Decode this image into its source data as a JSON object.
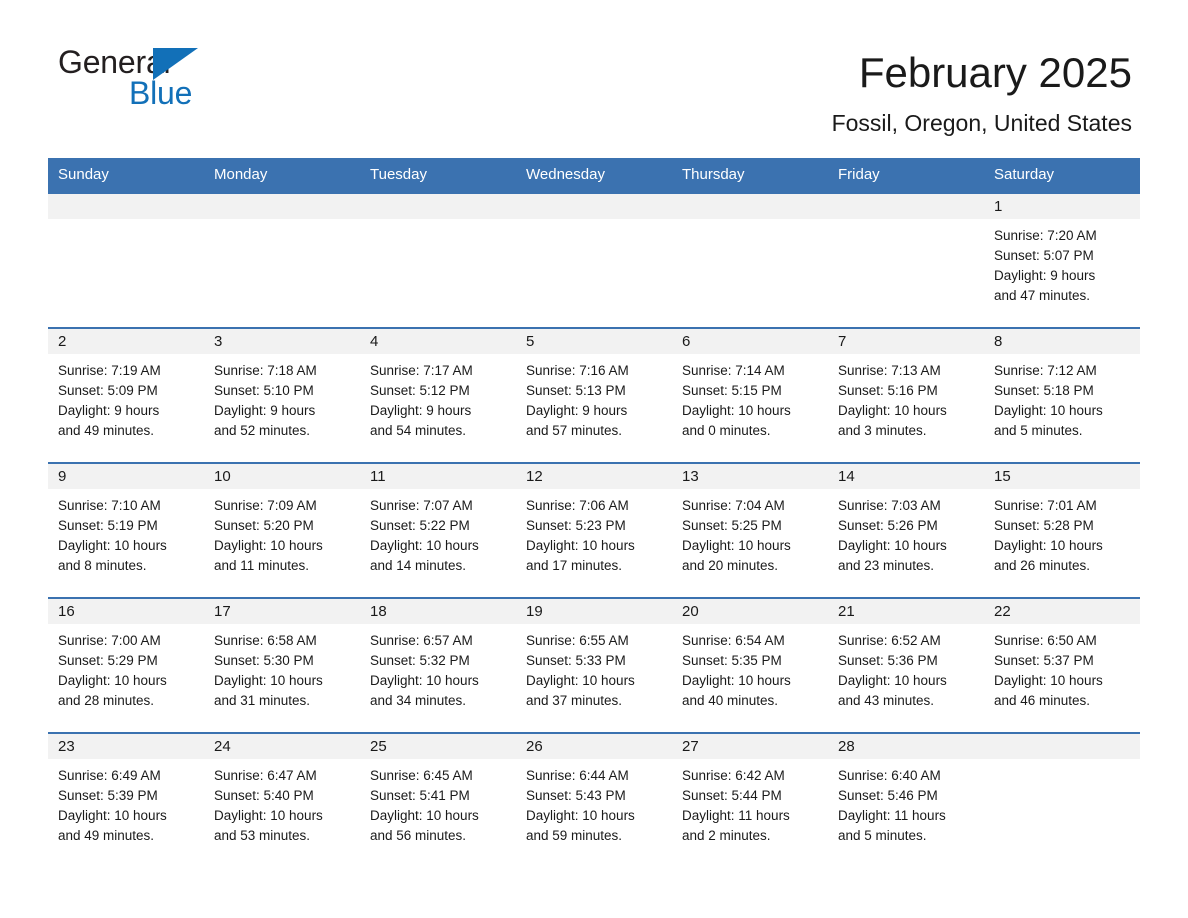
{
  "logo": {
    "word_general": "General",
    "word_blue": "Blue",
    "triangle_color": "#1270b8",
    "general_color": "#231f20",
    "blue_color": "#1270b8"
  },
  "header": {
    "month_title": "February 2025",
    "location": "Fossil, Oregon, United States",
    "header_bg_color": "#3b72b0",
    "row_border_color": "#3b72b0",
    "daynum_band_color": "#f2f2f2"
  },
  "weekdays": [
    "Sunday",
    "Monday",
    "Tuesday",
    "Wednesday",
    "Thursday",
    "Friday",
    "Saturday"
  ],
  "weeks": [
    [
      {
        "day": "",
        "sunrise": "",
        "sunset": "",
        "daylight_line1": "",
        "daylight_line2": "",
        "empty": true
      },
      {
        "day": "",
        "sunrise": "",
        "sunset": "",
        "daylight_line1": "",
        "daylight_line2": "",
        "empty": true
      },
      {
        "day": "",
        "sunrise": "",
        "sunset": "",
        "daylight_line1": "",
        "daylight_line2": "",
        "empty": true
      },
      {
        "day": "",
        "sunrise": "",
        "sunset": "",
        "daylight_line1": "",
        "daylight_line2": "",
        "empty": true
      },
      {
        "day": "",
        "sunrise": "",
        "sunset": "",
        "daylight_line1": "",
        "daylight_line2": "",
        "empty": true
      },
      {
        "day": "",
        "sunrise": "",
        "sunset": "",
        "daylight_line1": "",
        "daylight_line2": "",
        "empty": true
      },
      {
        "day": "1",
        "sunrise": "Sunrise: 7:20 AM",
        "sunset": "Sunset: 5:07 PM",
        "daylight_line1": "Daylight: 9 hours",
        "daylight_line2": "and 47 minutes.",
        "empty": false
      }
    ],
    [
      {
        "day": "2",
        "sunrise": "Sunrise: 7:19 AM",
        "sunset": "Sunset: 5:09 PM",
        "daylight_line1": "Daylight: 9 hours",
        "daylight_line2": "and 49 minutes.",
        "empty": false
      },
      {
        "day": "3",
        "sunrise": "Sunrise: 7:18 AM",
        "sunset": "Sunset: 5:10 PM",
        "daylight_line1": "Daylight: 9 hours",
        "daylight_line2": "and 52 minutes.",
        "empty": false
      },
      {
        "day": "4",
        "sunrise": "Sunrise: 7:17 AM",
        "sunset": "Sunset: 5:12 PM",
        "daylight_line1": "Daylight: 9 hours",
        "daylight_line2": "and 54 minutes.",
        "empty": false
      },
      {
        "day": "5",
        "sunrise": "Sunrise: 7:16 AM",
        "sunset": "Sunset: 5:13 PM",
        "daylight_line1": "Daylight: 9 hours",
        "daylight_line2": "and 57 minutes.",
        "empty": false
      },
      {
        "day": "6",
        "sunrise": "Sunrise: 7:14 AM",
        "sunset": "Sunset: 5:15 PM",
        "daylight_line1": "Daylight: 10 hours",
        "daylight_line2": "and 0 minutes.",
        "empty": false
      },
      {
        "day": "7",
        "sunrise": "Sunrise: 7:13 AM",
        "sunset": "Sunset: 5:16 PM",
        "daylight_line1": "Daylight: 10 hours",
        "daylight_line2": "and 3 minutes.",
        "empty": false
      },
      {
        "day": "8",
        "sunrise": "Sunrise: 7:12 AM",
        "sunset": "Sunset: 5:18 PM",
        "daylight_line1": "Daylight: 10 hours",
        "daylight_line2": "and 5 minutes.",
        "empty": false
      }
    ],
    [
      {
        "day": "9",
        "sunrise": "Sunrise: 7:10 AM",
        "sunset": "Sunset: 5:19 PM",
        "daylight_line1": "Daylight: 10 hours",
        "daylight_line2": "and 8 minutes.",
        "empty": false
      },
      {
        "day": "10",
        "sunrise": "Sunrise: 7:09 AM",
        "sunset": "Sunset: 5:20 PM",
        "daylight_line1": "Daylight: 10 hours",
        "daylight_line2": "and 11 minutes.",
        "empty": false
      },
      {
        "day": "11",
        "sunrise": "Sunrise: 7:07 AM",
        "sunset": "Sunset: 5:22 PM",
        "daylight_line1": "Daylight: 10 hours",
        "daylight_line2": "and 14 minutes.",
        "empty": false
      },
      {
        "day": "12",
        "sunrise": "Sunrise: 7:06 AM",
        "sunset": "Sunset: 5:23 PM",
        "daylight_line1": "Daylight: 10 hours",
        "daylight_line2": "and 17 minutes.",
        "empty": false
      },
      {
        "day": "13",
        "sunrise": "Sunrise: 7:04 AM",
        "sunset": "Sunset: 5:25 PM",
        "daylight_line1": "Daylight: 10 hours",
        "daylight_line2": "and 20 minutes.",
        "empty": false
      },
      {
        "day": "14",
        "sunrise": "Sunrise: 7:03 AM",
        "sunset": "Sunset: 5:26 PM",
        "daylight_line1": "Daylight: 10 hours",
        "daylight_line2": "and 23 minutes.",
        "empty": false
      },
      {
        "day": "15",
        "sunrise": "Sunrise: 7:01 AM",
        "sunset": "Sunset: 5:28 PM",
        "daylight_line1": "Daylight: 10 hours",
        "daylight_line2": "and 26 minutes.",
        "empty": false
      }
    ],
    [
      {
        "day": "16",
        "sunrise": "Sunrise: 7:00 AM",
        "sunset": "Sunset: 5:29 PM",
        "daylight_line1": "Daylight: 10 hours",
        "daylight_line2": "and 28 minutes.",
        "empty": false
      },
      {
        "day": "17",
        "sunrise": "Sunrise: 6:58 AM",
        "sunset": "Sunset: 5:30 PM",
        "daylight_line1": "Daylight: 10 hours",
        "daylight_line2": "and 31 minutes.",
        "empty": false
      },
      {
        "day": "18",
        "sunrise": "Sunrise: 6:57 AM",
        "sunset": "Sunset: 5:32 PM",
        "daylight_line1": "Daylight: 10 hours",
        "daylight_line2": "and 34 minutes.",
        "empty": false
      },
      {
        "day": "19",
        "sunrise": "Sunrise: 6:55 AM",
        "sunset": "Sunset: 5:33 PM",
        "daylight_line1": "Daylight: 10 hours",
        "daylight_line2": "and 37 minutes.",
        "empty": false
      },
      {
        "day": "20",
        "sunrise": "Sunrise: 6:54 AM",
        "sunset": "Sunset: 5:35 PM",
        "daylight_line1": "Daylight: 10 hours",
        "daylight_line2": "and 40 minutes.",
        "empty": false
      },
      {
        "day": "21",
        "sunrise": "Sunrise: 6:52 AM",
        "sunset": "Sunset: 5:36 PM",
        "daylight_line1": "Daylight: 10 hours",
        "daylight_line2": "and 43 minutes.",
        "empty": false
      },
      {
        "day": "22",
        "sunrise": "Sunrise: 6:50 AM",
        "sunset": "Sunset: 5:37 PM",
        "daylight_line1": "Daylight: 10 hours",
        "daylight_line2": "and 46 minutes.",
        "empty": false
      }
    ],
    [
      {
        "day": "23",
        "sunrise": "Sunrise: 6:49 AM",
        "sunset": "Sunset: 5:39 PM",
        "daylight_line1": "Daylight: 10 hours",
        "daylight_line2": "and 49 minutes.",
        "empty": false
      },
      {
        "day": "24",
        "sunrise": "Sunrise: 6:47 AM",
        "sunset": "Sunset: 5:40 PM",
        "daylight_line1": "Daylight: 10 hours",
        "daylight_line2": "and 53 minutes.",
        "empty": false
      },
      {
        "day": "25",
        "sunrise": "Sunrise: 6:45 AM",
        "sunset": "Sunset: 5:41 PM",
        "daylight_line1": "Daylight: 10 hours",
        "daylight_line2": "and 56 minutes.",
        "empty": false
      },
      {
        "day": "26",
        "sunrise": "Sunrise: 6:44 AM",
        "sunset": "Sunset: 5:43 PM",
        "daylight_line1": "Daylight: 10 hours",
        "daylight_line2": "and 59 minutes.",
        "empty": false
      },
      {
        "day": "27",
        "sunrise": "Sunrise: 6:42 AM",
        "sunset": "Sunset: 5:44 PM",
        "daylight_line1": "Daylight: 11 hours",
        "daylight_line2": "and 2 minutes.",
        "empty": false
      },
      {
        "day": "28",
        "sunrise": "Sunrise: 6:40 AM",
        "sunset": "Sunset: 5:46 PM",
        "daylight_line1": "Daylight: 11 hours",
        "daylight_line2": "and 5 minutes.",
        "empty": false
      },
      {
        "day": "",
        "sunrise": "",
        "sunset": "",
        "daylight_line1": "",
        "daylight_line2": "",
        "empty": true
      }
    ]
  ]
}
